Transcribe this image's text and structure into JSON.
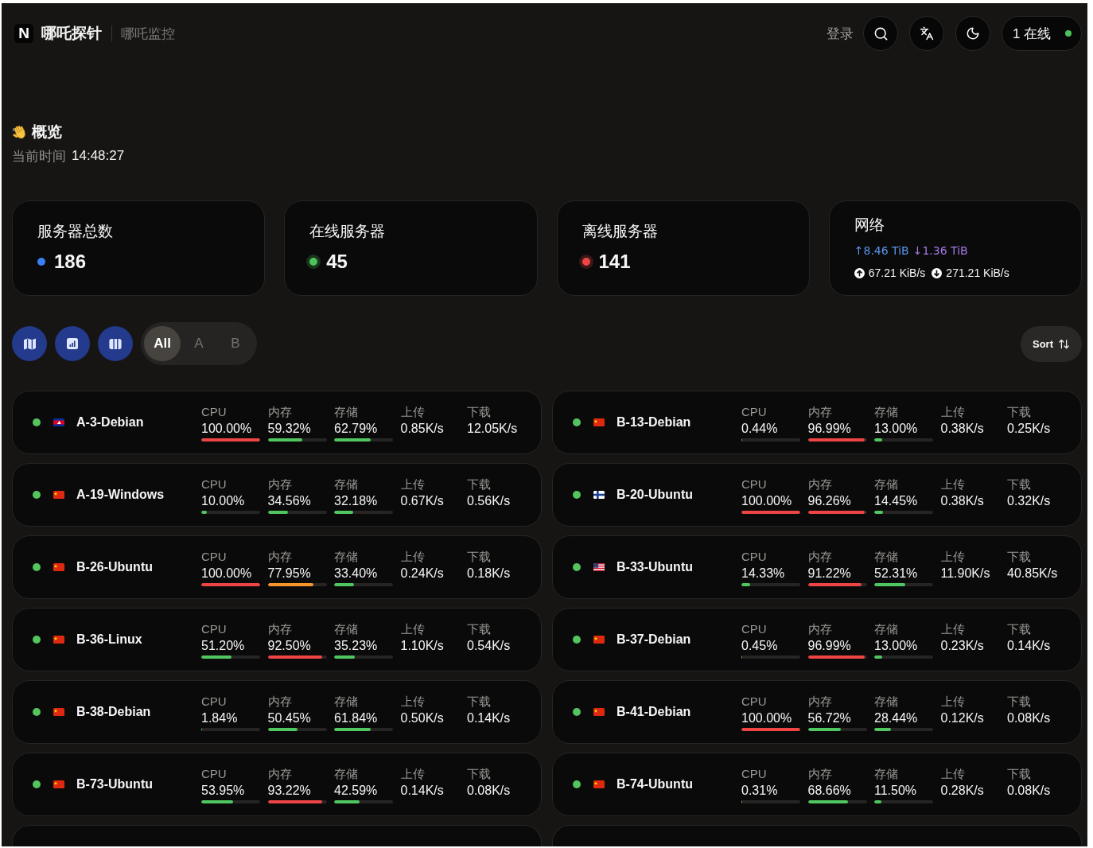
{
  "header": {
    "logo": "N",
    "title": "哪吒探针",
    "subtitle": "哪吒监控",
    "login": "登录",
    "online": {
      "label": "1 在线",
      "on": true
    }
  },
  "overview": {
    "title": "概览",
    "time_label": "当前时间",
    "time": "14:48:27"
  },
  "stats": [
    {
      "kind": "count",
      "title": "服务器总数",
      "value": "186",
      "color": "#3b7ff5",
      "ring": false
    },
    {
      "kind": "count",
      "title": "在线服务器",
      "value": "45",
      "color": "#4cc35a",
      "ring": true
    },
    {
      "kind": "count",
      "title": "离线服务器",
      "value": "141",
      "color": "#ef4444",
      "ring": true
    },
    {
      "kind": "network",
      "title": "网络",
      "totals": [
        {
          "text": "↑8.46 TiB",
          "color": "#5b95ee"
        },
        {
          "text": "↓1.36 TiB",
          "color": "#a679e8"
        }
      ],
      "speeds": [
        {
          "kind": "up",
          "text": "67.21 KiB/s"
        },
        {
          "kind": "down",
          "text": "271.21 KiB/s"
        }
      ]
    }
  ],
  "filters": [
    {
      "label": "All",
      "selected": true
    },
    {
      "label": "A",
      "selected": false
    },
    {
      "label": "B",
      "selected": false
    }
  ],
  "sort": {
    "label": "Sort"
  },
  "servers": [
    {
      "name": "A-3-Debian",
      "online": true,
      "kind": "cambodia",
      "metrics": [
        {
          "kind": "usage",
          "label": "CPU",
          "value": "100.00%",
          "level": 1.0
        },
        {
          "kind": "usage",
          "label": "内存",
          "value": "59.32%",
          "level": 0.5932
        },
        {
          "kind": "usage",
          "label": "存储",
          "value": "62.79%",
          "level": 0.6279
        },
        {
          "kind": "rate",
          "label": "上传",
          "value": "0.85K/s"
        },
        {
          "kind": "rate",
          "label": "下载",
          "value": "12.05K/s"
        }
      ]
    },
    {
      "name": "B-13-Debian",
      "online": true,
      "kind": "china",
      "metrics": [
        {
          "kind": "usage",
          "label": "CPU",
          "value": "0.44%",
          "level": 0.0044
        },
        {
          "kind": "usage",
          "label": "内存",
          "value": "96.99%",
          "level": 0.9699
        },
        {
          "kind": "usage",
          "label": "存储",
          "value": "13.00%",
          "level": 0.13
        },
        {
          "kind": "rate",
          "label": "上传",
          "value": "0.38K/s"
        },
        {
          "kind": "rate",
          "label": "下载",
          "value": "0.25K/s"
        }
      ]
    },
    {
      "name": "A-19-Windows",
      "online": true,
      "kind": "china",
      "metrics": [
        {
          "kind": "usage",
          "label": "CPU",
          "value": "10.00%",
          "level": 0.1
        },
        {
          "kind": "usage",
          "label": "内存",
          "value": "34.56%",
          "level": 0.3456
        },
        {
          "kind": "usage",
          "label": "存储",
          "value": "32.18%",
          "level": 0.3218
        },
        {
          "kind": "rate",
          "label": "上传",
          "value": "0.67K/s"
        },
        {
          "kind": "rate",
          "label": "下载",
          "value": "0.56K/s"
        }
      ]
    },
    {
      "name": "B-20-Ubuntu",
      "online": true,
      "kind": "finland",
      "metrics": [
        {
          "kind": "usage",
          "label": "CPU",
          "value": "100.00%",
          "level": 1.0
        },
        {
          "kind": "usage",
          "label": "内存",
          "value": "96.26%",
          "level": 0.9626
        },
        {
          "kind": "usage",
          "label": "存储",
          "value": "14.45%",
          "level": 0.1445
        },
        {
          "kind": "rate",
          "label": "上传",
          "value": "0.38K/s"
        },
        {
          "kind": "rate",
          "label": "下载",
          "value": "0.32K/s"
        }
      ]
    },
    {
      "name": "B-26-Ubuntu",
      "online": true,
      "kind": "china",
      "metrics": [
        {
          "kind": "usage",
          "label": "CPU",
          "value": "100.00%",
          "level": 1.0
        },
        {
          "kind": "usage",
          "label": "内存",
          "value": "77.95%",
          "level": 0.7795
        },
        {
          "kind": "usage",
          "label": "存储",
          "value": "33.40%",
          "level": 0.334
        },
        {
          "kind": "rate",
          "label": "上传",
          "value": "0.24K/s"
        },
        {
          "kind": "rate",
          "label": "下载",
          "value": "0.18K/s"
        }
      ]
    },
    {
      "name": "B-33-Ubuntu",
      "online": true,
      "kind": "usa",
      "metrics": [
        {
          "kind": "usage",
          "label": "CPU",
          "value": "14.33%",
          "level": 0.1433
        },
        {
          "kind": "usage",
          "label": "内存",
          "value": "91.22%",
          "level": 0.9122
        },
        {
          "kind": "usage",
          "label": "存储",
          "value": "52.31%",
          "level": 0.5231
        },
        {
          "kind": "rate",
          "label": "上传",
          "value": "11.90K/s"
        },
        {
          "kind": "rate",
          "label": "下载",
          "value": "40.85K/s"
        }
      ]
    },
    {
      "name": "B-36-Linux",
      "online": true,
      "kind": "china",
      "metrics": [
        {
          "kind": "usage",
          "label": "CPU",
          "value": "51.20%",
          "level": 0.512
        },
        {
          "kind": "usage",
          "label": "内存",
          "value": "92.50%",
          "level": 0.925
        },
        {
          "kind": "usage",
          "label": "存储",
          "value": "35.23%",
          "level": 0.3523
        },
        {
          "kind": "rate",
          "label": "上传",
          "value": "1.10K/s"
        },
        {
          "kind": "rate",
          "label": "下载",
          "value": "0.54K/s"
        }
      ]
    },
    {
      "name": "B-37-Debian",
      "online": true,
      "kind": "china",
      "metrics": [
        {
          "kind": "usage",
          "label": "CPU",
          "value": "0.45%",
          "level": 0.0045
        },
        {
          "kind": "usage",
          "label": "内存",
          "value": "96.99%",
          "level": 0.9699
        },
        {
          "kind": "usage",
          "label": "存储",
          "value": "13.00%",
          "level": 0.13
        },
        {
          "kind": "rate",
          "label": "上传",
          "value": "0.23K/s"
        },
        {
          "kind": "rate",
          "label": "下载",
          "value": "0.14K/s"
        }
      ]
    },
    {
      "name": "B-38-Debian",
      "online": true,
      "kind": "china",
      "metrics": [
        {
          "kind": "usage",
          "label": "CPU",
          "value": "1.84%",
          "level": 0.0184
        },
        {
          "kind": "usage",
          "label": "内存",
          "value": "50.45%",
          "level": 0.5045
        },
        {
          "kind": "usage",
          "label": "存储",
          "value": "61.84%",
          "level": 0.6184
        },
        {
          "kind": "rate",
          "label": "上传",
          "value": "0.50K/s"
        },
        {
          "kind": "rate",
          "label": "下载",
          "value": "0.14K/s"
        }
      ]
    },
    {
      "name": "B-41-Debian",
      "online": true,
      "kind": "china",
      "metrics": [
        {
          "kind": "usage",
          "label": "CPU",
          "value": "100.00%",
          "level": 1.0
        },
        {
          "kind": "usage",
          "label": "内存",
          "value": "56.72%",
          "level": 0.5672
        },
        {
          "kind": "usage",
          "label": "存储",
          "value": "28.44%",
          "level": 0.2844
        },
        {
          "kind": "rate",
          "label": "上传",
          "value": "0.12K/s"
        },
        {
          "kind": "rate",
          "label": "下载",
          "value": "0.08K/s"
        }
      ]
    },
    {
      "name": "B-73-Ubuntu",
      "online": true,
      "kind": "china",
      "metrics": [
        {
          "kind": "usage",
          "label": "CPU",
          "value": "53.95%",
          "level": 0.5395
        },
        {
          "kind": "usage",
          "label": "内存",
          "value": "93.22%",
          "level": 0.9322
        },
        {
          "kind": "usage",
          "label": "存储",
          "value": "42.59%",
          "level": 0.4259
        },
        {
          "kind": "rate",
          "label": "上传",
          "value": "0.14K/s"
        },
        {
          "kind": "rate",
          "label": "下载",
          "value": "0.08K/s"
        }
      ]
    },
    {
      "name": "B-74-Ubuntu",
      "online": true,
      "kind": "china",
      "metrics": [
        {
          "kind": "usage",
          "label": "CPU",
          "value": "0.31%",
          "level": 0.0031
        },
        {
          "kind": "usage",
          "label": "内存",
          "value": "68.66%",
          "level": 0.6866
        },
        {
          "kind": "usage",
          "label": "存储",
          "value": "11.50%",
          "level": 0.115
        },
        {
          "kind": "rate",
          "label": "上传",
          "value": "0.28K/s"
        },
        {
          "kind": "rate",
          "label": "下载",
          "value": "0.08K/s"
        }
      ]
    }
  ]
}
